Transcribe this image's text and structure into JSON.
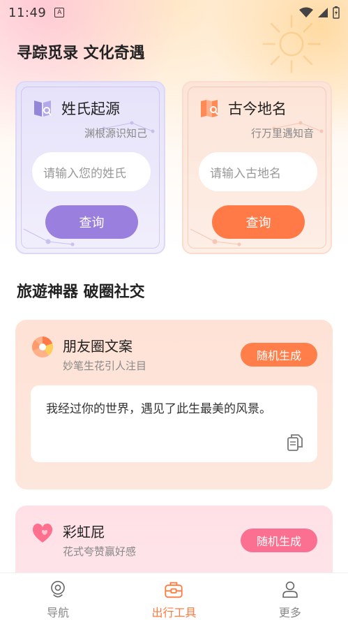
{
  "status_bar": {
    "time": "11:49",
    "app_icon": "A"
  },
  "section1": {
    "title": "寻踪觅录 文化奇遇"
  },
  "surname_card": {
    "title": "姓氏起源",
    "subtitle": "渊根源识知己",
    "input_placeholder": "请输入您的姓氏",
    "button_label": "查询",
    "icon": "surname-book-icon",
    "accent": "#9a7fde"
  },
  "place_card": {
    "title": "古今地名",
    "subtitle": "行万里遇知音",
    "input_placeholder": "请输入古地名",
    "button_label": "查询",
    "icon": "map-icon",
    "accent": "#ff7a47"
  },
  "section2": {
    "title": "旅遊神器 破圈社交"
  },
  "moments_card": {
    "title": "朋友圈文案",
    "subtitle": "妙笔生花引人注目",
    "button_label": "随机生成",
    "text": "我经过你的世界，遇见了此生最美的风景。",
    "icon": "camera-aperture-icon"
  },
  "rainbow_card": {
    "title": "彩虹屁",
    "subtitle": "花式夸赞赢好感",
    "button_label": "随机生成",
    "icon": "heart-icon"
  },
  "bottom_nav": {
    "items": [
      {
        "label": "导航",
        "icon": "navigation-pin-icon",
        "active": false
      },
      {
        "label": "出行工具",
        "icon": "toolbox-icon",
        "active": true
      },
      {
        "label": "更多",
        "icon": "user-icon",
        "active": false
      }
    ],
    "active_color": "#ff7a3d"
  }
}
